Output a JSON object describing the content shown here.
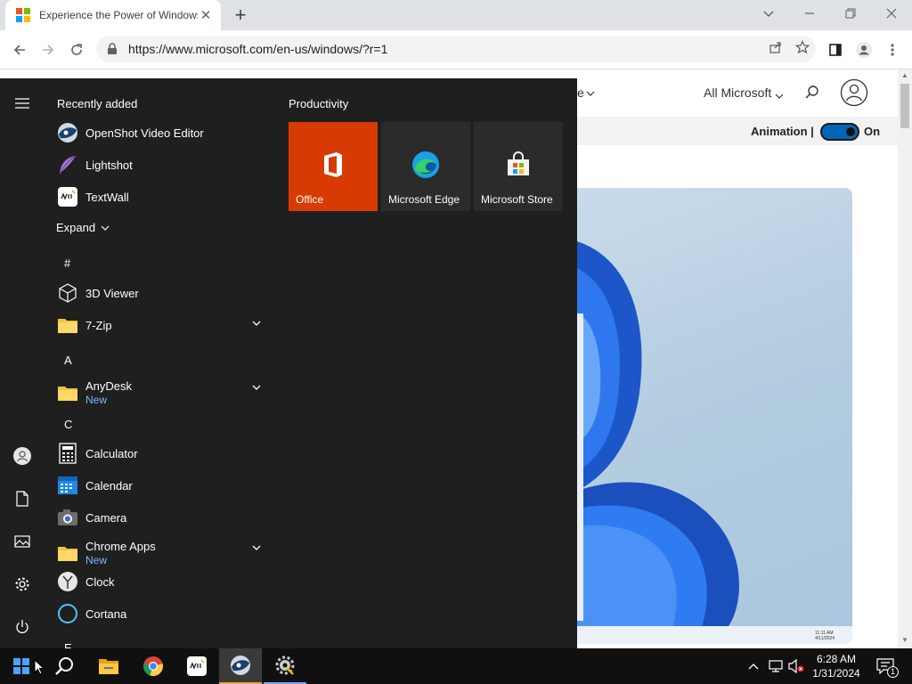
{
  "browser": {
    "tab_title": "Experience the Power of Windows",
    "tab_close": "✕",
    "new_tab": "+",
    "url": "https://www.microsoft.com/en-us/windows/?r=1"
  },
  "webpage": {
    "nav_partial": "e",
    "all_microsoft": "All Microsoft",
    "animation_label": "Animation |",
    "animation_state": "On",
    "hero_time": "11:11 AM",
    "hero_date": "4/11/2024"
  },
  "start_menu": {
    "recently_added_label": "Recently added",
    "recent_apps": [
      {
        "name": "OpenShot Video Editor"
      },
      {
        "name": "Lightshot"
      },
      {
        "name": "TextWall"
      }
    ],
    "expand_label": "Expand",
    "letters": [
      "#",
      "A",
      "C",
      "E"
    ],
    "apps": [
      {
        "name": "3D Viewer"
      },
      {
        "name": "7-Zip"
      },
      {
        "name": "AnyDesk",
        "badge": "New"
      },
      {
        "name": "Calculator"
      },
      {
        "name": "Calendar"
      },
      {
        "name": "Camera"
      },
      {
        "name": "Chrome Apps",
        "badge": "New"
      },
      {
        "name": "Clock"
      },
      {
        "name": "Cortana"
      }
    ],
    "tiles_group": "Productivity",
    "tiles": [
      {
        "name": "Office",
        "color": "#d83b01"
      },
      {
        "name": "Microsoft Edge",
        "color": "#2b2b2b"
      },
      {
        "name": "Microsoft Store",
        "color": "#2b2b2b"
      }
    ]
  },
  "taskbar": {
    "time": "6:28 AM",
    "date": "1/31/2024",
    "notification_count": "1"
  },
  "colors": {
    "start_bg": "#1f1f1f",
    "taskbar_bg": "#101010",
    "accent_blue": "#0067b8",
    "office_orange": "#d83b01"
  }
}
